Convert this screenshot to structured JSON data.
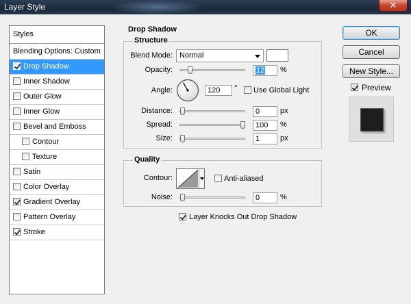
{
  "window": {
    "title": "Layer Style",
    "close_glyph": "✕"
  },
  "styles": {
    "header": "Styles",
    "items": [
      {
        "label": "Blending Options: Custom",
        "has_checkbox": false,
        "checked": false,
        "selected": false,
        "indent": false
      },
      {
        "label": "Drop Shadow",
        "has_checkbox": true,
        "checked": true,
        "selected": true,
        "indent": false
      },
      {
        "label": "Inner Shadow",
        "has_checkbox": true,
        "checked": false,
        "selected": false,
        "indent": false
      },
      {
        "label": "Outer Glow",
        "has_checkbox": true,
        "checked": false,
        "selected": false,
        "indent": false
      },
      {
        "label": "Inner Glow",
        "has_checkbox": true,
        "checked": false,
        "selected": false,
        "indent": false
      },
      {
        "label": "Bevel and Emboss",
        "has_checkbox": true,
        "checked": false,
        "selected": false,
        "indent": false
      },
      {
        "label": "Contour",
        "has_checkbox": true,
        "checked": false,
        "selected": false,
        "indent": true
      },
      {
        "label": "Texture",
        "has_checkbox": true,
        "checked": false,
        "selected": false,
        "indent": true
      },
      {
        "label": "Satin",
        "has_checkbox": true,
        "checked": false,
        "selected": false,
        "indent": false
      },
      {
        "label": "Color Overlay",
        "has_checkbox": true,
        "checked": false,
        "selected": false,
        "indent": false
      },
      {
        "label": "Gradient Overlay",
        "has_checkbox": true,
        "checked": true,
        "selected": false,
        "indent": false
      },
      {
        "label": "Pattern Overlay",
        "has_checkbox": true,
        "checked": false,
        "selected": false,
        "indent": false
      },
      {
        "label": "Stroke",
        "has_checkbox": true,
        "checked": true,
        "selected": false,
        "indent": false
      }
    ]
  },
  "drop_shadow": {
    "title": "Drop Shadow",
    "structure": {
      "title": "Structure",
      "blend_mode_label": "Blend Mode:",
      "blend_mode_value": "Normal",
      "shadow_color": "#ffffff",
      "opacity_label": "Opacity:",
      "opacity_value": "12",
      "opacity_unit": "%",
      "opacity_percent": 12,
      "angle_label": "Angle:",
      "angle_value": "120",
      "angle_unit": "°",
      "angle_degrees": 120,
      "global_light_label": "Use Global Light",
      "global_light_checked": false,
      "distance_label": "Distance:",
      "distance_value": "0",
      "distance_unit": "px",
      "distance_fraction": 0,
      "spread_label": "Spread:",
      "spread_value": "100",
      "spread_unit": "%",
      "spread_fraction": 1,
      "size_label": "Size:",
      "size_value": "1",
      "size_unit": "px",
      "size_fraction": 0.004
    },
    "quality": {
      "title": "Quality",
      "contour_label": "Contour:",
      "anti_aliased_label": "Anti-aliased",
      "anti_aliased_checked": false,
      "noise_label": "Noise:",
      "noise_value": "0",
      "noise_unit": "%",
      "noise_fraction": 0
    },
    "knocks_out_label": "Layer Knocks Out Drop Shadow",
    "knocks_out_checked": true
  },
  "buttons": {
    "ok": "OK",
    "cancel": "Cancel",
    "new_style": "New Style...",
    "preview_label": "Preview",
    "preview_checked": true
  }
}
